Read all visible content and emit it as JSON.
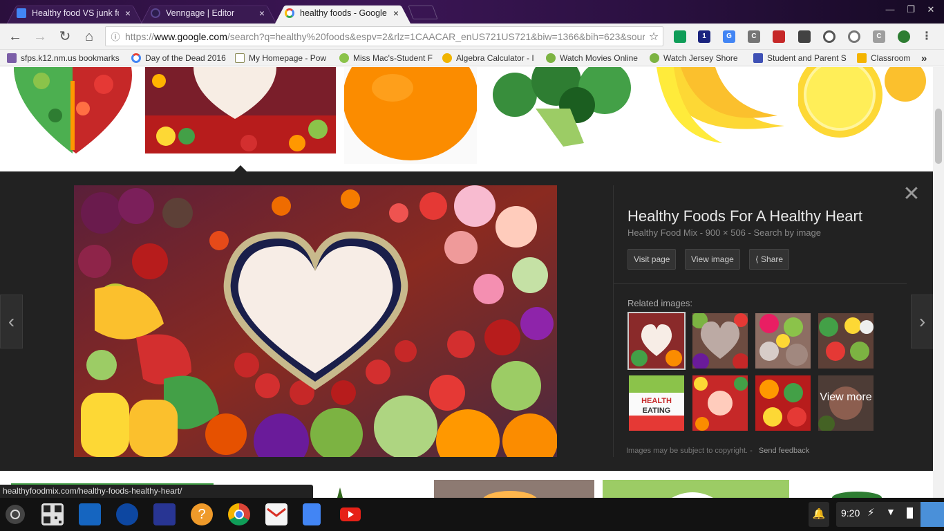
{
  "tabs": [
    {
      "title": "Healthy food VS junk fo",
      "favicon": "google-docs-icon",
      "color": "#4285f4",
      "active": false
    },
    {
      "title": "Venngage | Editor",
      "favicon": "venngage-icon",
      "color": "#3b2a5a",
      "active": false
    },
    {
      "title": "healthy foods - Google",
      "favicon": "google-icon",
      "color": "#ea4335",
      "active": true
    }
  ],
  "window_controls": {
    "minimize": "—",
    "restore": "❐",
    "close": "✕"
  },
  "toolbar": {
    "back": "←",
    "forward": "→",
    "reload": "↻",
    "home": "⌂",
    "url_prefix": "https://",
    "url_host": "www.google.com",
    "url_path": "/search?q=healthy%20foods&espv=2&rlz=1CAACAR_enUS721US721&biw=1366&bih=623&sour",
    "star": "☆"
  },
  "extensions": [
    {
      "name": "classroom-ext-icon",
      "color": "#0f9d58",
      "label": ""
    },
    {
      "name": "onetab-icon",
      "color": "#1a237e",
      "label": "1"
    },
    {
      "name": "google-translate-icon",
      "color": "#4285f4",
      "label": "G"
    },
    {
      "name": "extension-c-icon",
      "color": "#757575",
      "label": "C"
    },
    {
      "name": "book-icon",
      "color": "#c62828",
      "label": ""
    },
    {
      "name": "pen-tool-icon",
      "color": "#424242",
      "label": ""
    },
    {
      "name": "circle-ext-icon",
      "color": "#616161",
      "label": ""
    },
    {
      "name": "clock-ext-icon",
      "color": "#757575",
      "label": ""
    },
    {
      "name": "extension-c2-icon",
      "color": "#9e9e9e",
      "label": "C"
    },
    {
      "name": "power-ext-icon",
      "color": "#2e7d32",
      "label": ""
    },
    {
      "name": "menu-icon",
      "color": "#f2f2f2",
      "label": "⋮"
    }
  ],
  "bookmarks": [
    {
      "label": "sfps.k12.nm.us bookmarks",
      "icon": "folder-icon",
      "color": "#7b5ea7"
    },
    {
      "label": "Day of the Dead 2016",
      "icon": "google-icon",
      "color": "#ea4335"
    },
    {
      "label": "My Homepage - Pow",
      "icon": "homepage-icon",
      "color": "#8d8d5a"
    },
    {
      "label": "Miss Mac's-Student F",
      "icon": "apple-icon",
      "color": "#8bc34a"
    },
    {
      "label": "Algebra Calculator - I",
      "icon": "calculator-icon",
      "color": "#f0b400"
    },
    {
      "label": "Watch Movies Online",
      "icon": "play-icon",
      "color": "#7cb342"
    },
    {
      "label": "Watch Jersey Shore",
      "icon": "play-icon",
      "color": "#7cb342"
    },
    {
      "label": "Student and Parent S",
      "icon": "p-icon",
      "color": "#3f51b5"
    },
    {
      "label": "Classroom",
      "icon": "classroom-icon",
      "color": "#f4b400"
    }
  ],
  "bookmarks_overflow": "»",
  "panel": {
    "title": "Healthy Foods For A Healthy Heart",
    "subtitle": "Healthy Food Mix - 900 × 506 - Search by image",
    "buttons": {
      "visit": "Visit page",
      "view": "View image",
      "share": "Share"
    },
    "related_label": "Related images:",
    "view_more": "View more",
    "copyright": "Images may be subject to copyright.",
    "feedback": "Send feedback",
    "close": "✕",
    "prev": "‹",
    "next": "›"
  },
  "status_url": "healthyfoodmix.com/healthy-foods-healthy-heart/",
  "shelf": {
    "time": "9:20",
    "apps": [
      {
        "name": "qr-code-app-icon",
        "color": "#e0e0e0"
      },
      {
        "name": "discovery-education-icon",
        "color": "#1565c0"
      },
      {
        "name": "sra-app-icon",
        "color": "#0d47a1"
      },
      {
        "name": "dance-app-icon",
        "color": "#283593"
      },
      {
        "name": "help-app-icon",
        "color": "#ef9a2a"
      },
      {
        "name": "chrome-icon",
        "color": "#db4437"
      },
      {
        "name": "gmail-icon",
        "color": "#f5f5f5"
      },
      {
        "name": "google-docs-icon",
        "color": "#4285f4"
      },
      {
        "name": "youtube-icon",
        "color": "#e62117"
      }
    ]
  }
}
